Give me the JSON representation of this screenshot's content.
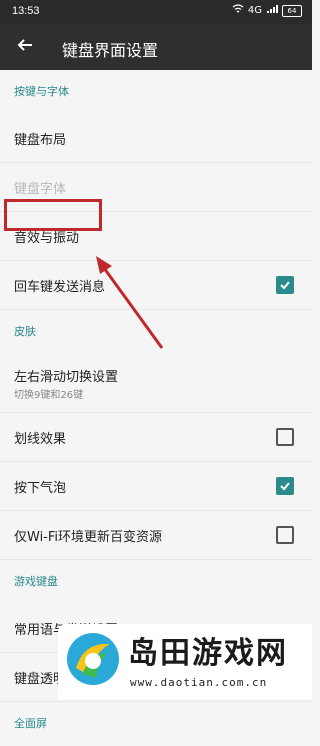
{
  "status": {
    "time": "13:53",
    "network": "4G",
    "battery": "64"
  },
  "appbar": {
    "title": "键盘界面设置"
  },
  "sections": {
    "keys_fonts": "按键与字体",
    "skin": "皮肤",
    "game_keyboard": "游戏键盘",
    "fullscreen": "全面屏"
  },
  "items": {
    "keyboard_layout": "键盘布局",
    "keyboard_font": "键盘字体",
    "sound_vibration": "音效与振动",
    "enter_send": "回车键发送消息",
    "swipe_switch": "左右滑动切换设置",
    "swipe_switch_sub": "切换9键和26键",
    "swipe_effect": "划线效果",
    "press_bubble": "按下气泡",
    "wifi_update": "仅Wi-Fi环境更新百变资源",
    "common_phrases": "常用语与发送设置",
    "keyboard_transparency": "键盘透明度"
  },
  "checkboxes": {
    "enter_send": true,
    "swipe_effect": false,
    "press_bubble": true,
    "wifi_update": false
  },
  "watermark": {
    "brand": "岛田游戏网",
    "url": "www.daotian.com.cn"
  },
  "colors": {
    "accent": "#2a8a8c",
    "highlight": "#c0292b",
    "appbar": "#2f2f2f"
  }
}
